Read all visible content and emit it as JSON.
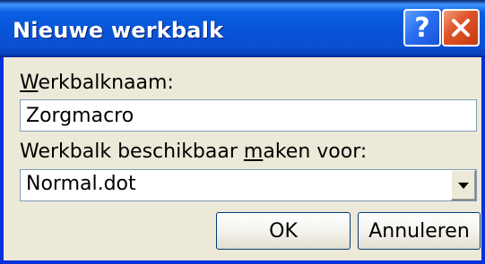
{
  "window": {
    "title": "Nieuwe werkbalk",
    "help_label": "?",
    "title_color": "#0a5fe0",
    "close_color": "#e0552a"
  },
  "form": {
    "name_label_accel": "W",
    "name_label_rest": "erkbalknaam:",
    "name_value": "Zorgmacro",
    "available_label_before": "Werkbalk beschikbaar ",
    "available_label_accel": "m",
    "available_label_after": "aken voor:",
    "available_value": "Normal.dot"
  },
  "buttons": {
    "ok_label": "OK",
    "cancel_label": "Annuleren"
  }
}
